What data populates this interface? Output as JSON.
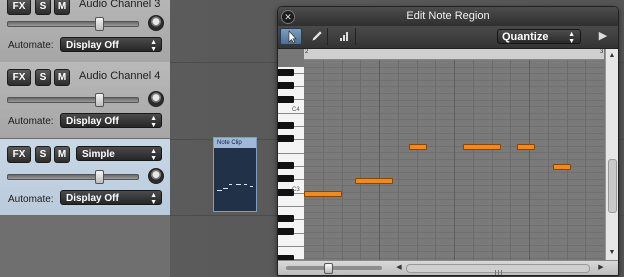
{
  "channels": [
    {
      "name": "Audio Channel 3",
      "fx_label": "FX",
      "solo_label": "S",
      "mute_label": "M",
      "automate_label": "Automate:",
      "automate_value": "Display Off",
      "volume": 0.7,
      "selected": false
    },
    {
      "name": "Audio Channel 4",
      "fx_label": "FX",
      "solo_label": "S",
      "mute_label": "M",
      "automate_label": "Automate:",
      "automate_value": "Display Off",
      "volume": 0.7,
      "selected": false
    },
    {
      "name": "",
      "preset": "Simple",
      "fx_label": "FX",
      "solo_label": "S",
      "mute_label": "M",
      "automate_label": "Automate:",
      "automate_value": "Display Off",
      "volume": 0.7,
      "selected": true
    }
  ],
  "clip": {
    "title": "Note Clip"
  },
  "editor": {
    "title": "Edit Note Region",
    "close_icon": "close-icon",
    "quantize_label": "Quantize",
    "ruler_numbers": [
      "2",
      "3"
    ],
    "c_labels": [
      "C4",
      "C3"
    ],
    "notes": [
      {
        "pitch": "C3",
        "start": 0.0,
        "length": 0.125
      },
      {
        "pitch": "D3",
        "start": 0.17,
        "length": 0.125
      },
      {
        "pitch": "G3",
        "start": 0.35,
        "length": 0.06
      },
      {
        "pitch": "G3",
        "start": 0.53,
        "length": 0.125
      },
      {
        "pitch": "G3",
        "start": 0.71,
        "length": 0.06
      },
      {
        "pitch": "E3",
        "start": 0.83,
        "length": 0.06
      }
    ],
    "zoom": 0.45
  },
  "colors": {
    "note_fill": "#f08a1e",
    "selected_strip": "#c0d0e0",
    "clip_bg": "#203148"
  }
}
